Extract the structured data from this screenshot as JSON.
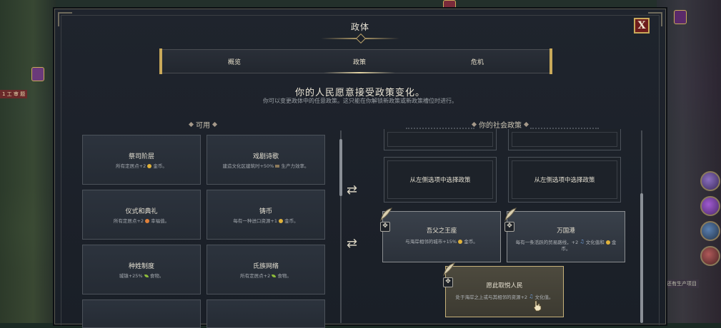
{
  "dialog": {
    "title": "政体",
    "close_label": "X",
    "tabs": [
      {
        "label": "概览",
        "active": false
      },
      {
        "label": "政策",
        "active": true
      },
      {
        "label": "危机",
        "active": false
      }
    ],
    "headline": "你的人民愿意接受政策变化。",
    "subline": "你可以变更政体中的任意政策。这只能在你解锁新政策或新政策槽位时进行。"
  },
  "available": {
    "heading": "可用",
    "cards": [
      {
        "title": "祭司阶层",
        "desc": "所有定居点+2",
        "icon": "gold-icon",
        "suffix": "金币。"
      },
      {
        "title": "戏剧诗歌",
        "desc": "建造文化区建筑时+50%",
        "icon": "production-icon",
        "suffix": "生产力效率。"
      },
      {
        "title": "仪式和典礼",
        "desc": "所有定居点+2",
        "icon": "happiness-icon",
        "suffix": "幸福值。"
      },
      {
        "title": "铸币",
        "desc": "每有一种进口资源+1",
        "icon": "gold-icon",
        "suffix": "金币。"
      },
      {
        "title": "种姓制度",
        "desc": "城镇+25%",
        "icon": "food-icon",
        "suffix": "食物。"
      },
      {
        "title": "氏族网络",
        "desc": "所有定居点+2",
        "icon": "food-icon",
        "suffix": "食物。"
      },
      {
        "title": "",
        "desc": "",
        "icon": "",
        "suffix": ""
      },
      {
        "title": "",
        "desc": "",
        "icon": "",
        "suffix": ""
      }
    ]
  },
  "social": {
    "heading": "你的社会政策",
    "empty_slot_label": "从左侧选项中选择政策",
    "filled": [
      {
        "title": "吾父之王座",
        "desc": "与海岸相邻的城市+15%",
        "icon": "gold-icon",
        "suffix": "金币。"
      },
      {
        "title": "万国港",
        "desc": "每有一条活跃的贸易路线，+2",
        "icon": "culture-icon",
        "suffix": "文化值和",
        "extra": "金币。"
      },
      {
        "title": "愿此取悦人民",
        "desc": "处于海岸之上或与其相邻的资源+2",
        "icon": "culture-icon",
        "suffix": "文化值。"
      }
    ]
  },
  "map": {
    "left_label": "1 工 审 题",
    "right_label": "还有生产项目"
  },
  "colors": {
    "accent_gold": "#c9a95a",
    "close_red": "#6e1c1c",
    "panel_bg": "#1f242d",
    "highlight_card": "#4d4a3e"
  }
}
